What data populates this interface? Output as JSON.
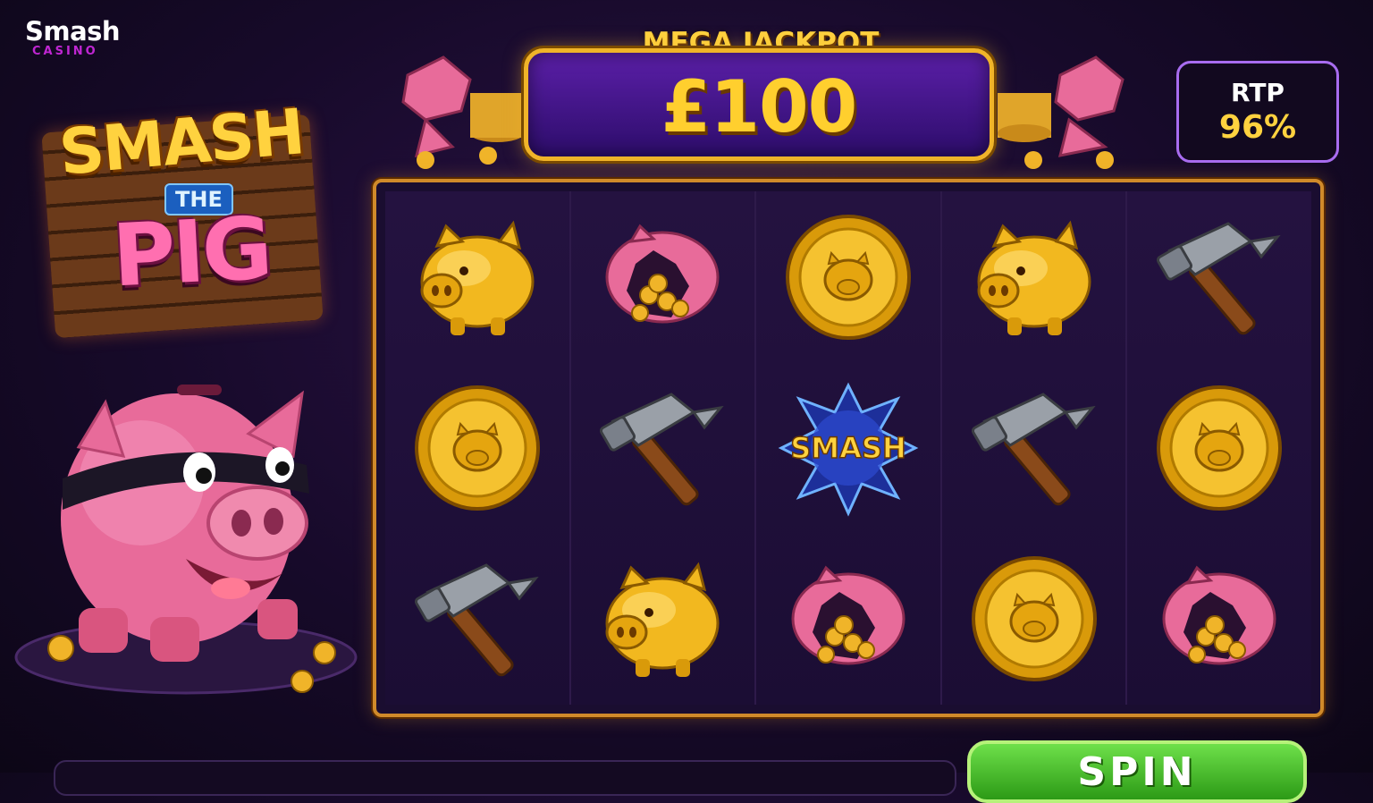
{
  "brand": {
    "name": "Smash",
    "sub": "CASINO"
  },
  "logo": {
    "line1": "SMASH",
    "line2": "THE",
    "line3": "PIG"
  },
  "jackpot": {
    "title": "MEGA JACKPOT",
    "amount": "£100"
  },
  "rtp": {
    "label": "RTP",
    "value": "96%"
  },
  "reels": [
    [
      "gold-pig",
      "gold-coin",
      "hammer"
    ],
    [
      "broken-pig",
      "hammer",
      "gold-pig"
    ],
    [
      "gold-coin",
      "smash",
      "broken-pig"
    ],
    [
      "gold-pig",
      "hammer",
      "gold-coin"
    ],
    [
      "hammer",
      "gold-coin",
      "broken-pig"
    ]
  ],
  "smash_symbol_text": "SMASH",
  "spin": {
    "label": "SPIN"
  },
  "colors": {
    "gold": "#ffd23f",
    "pink": "#ff6fb0",
    "purple": "#5b1fa8",
    "frame": "#d08a2a",
    "spin": "#3cb521"
  }
}
